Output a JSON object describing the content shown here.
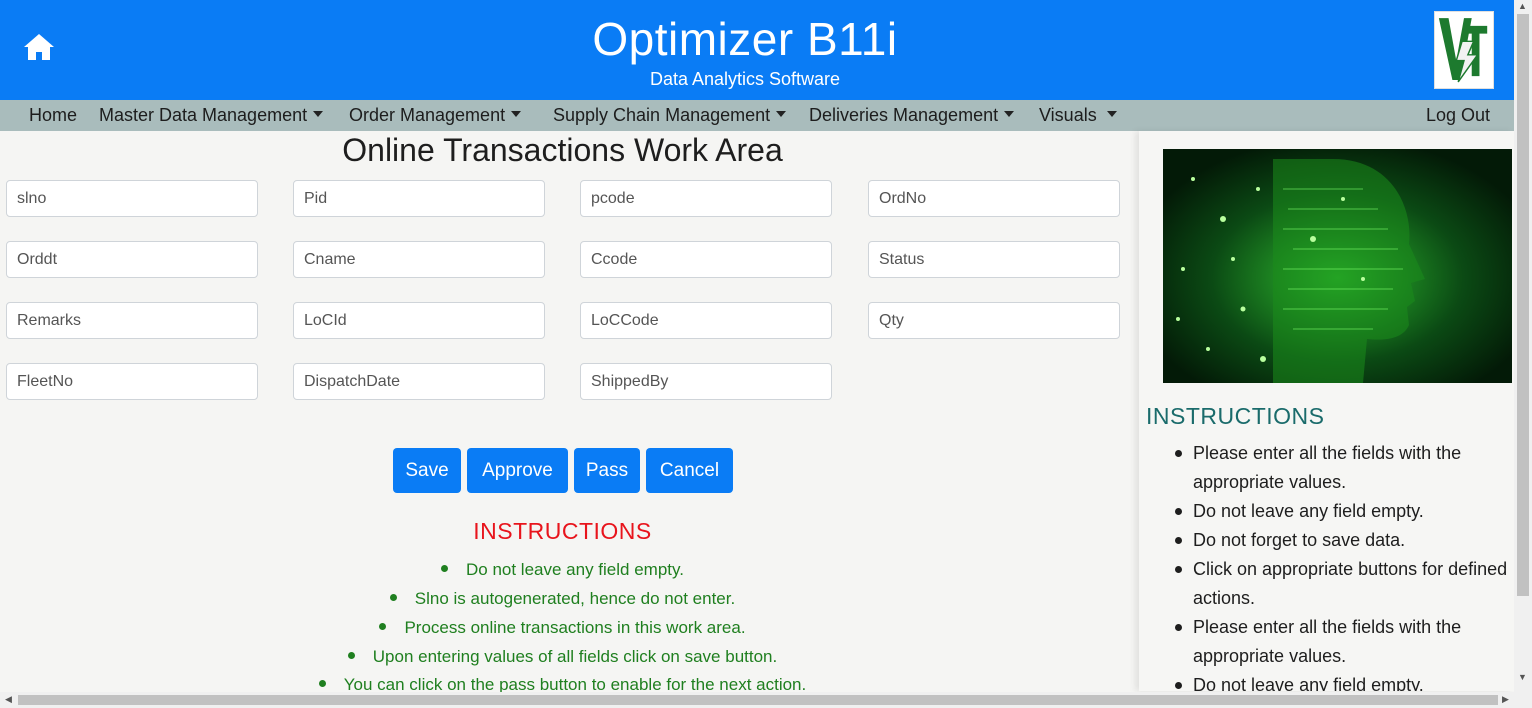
{
  "header": {
    "title": "Optimizer B11i",
    "subtitle": "Data Analytics Software",
    "brand_color": "#0a7cf5"
  },
  "nav": {
    "items": [
      {
        "label": "Home",
        "dropdown": false
      },
      {
        "label": "Master Data Management",
        "dropdown": true
      },
      {
        "label": "Order Management",
        "dropdown": true
      },
      {
        "label": "Supply Chain Management",
        "dropdown": true
      },
      {
        "label": "Deliveries Management",
        "dropdown": true
      },
      {
        "label": "Visuals",
        "dropdown": true
      }
    ],
    "logout": "Log Out"
  },
  "work_area": {
    "title": "Online Transactions Work Area",
    "fields": [
      {
        "placeholder": "slno",
        "value": ""
      },
      {
        "placeholder": "Pid",
        "value": ""
      },
      {
        "placeholder": "pcode",
        "value": ""
      },
      {
        "placeholder": "OrdNo",
        "value": ""
      },
      {
        "placeholder": "Orddt",
        "value": ""
      },
      {
        "placeholder": "Cname",
        "value": ""
      },
      {
        "placeholder": "Ccode",
        "value": ""
      },
      {
        "placeholder": "Status",
        "value": ""
      },
      {
        "placeholder": "Remarks",
        "value": ""
      },
      {
        "placeholder": "LoCId",
        "value": ""
      },
      {
        "placeholder": "LoCCode",
        "value": ""
      },
      {
        "placeholder": "Qty",
        "value": ""
      },
      {
        "placeholder": "FleetNo",
        "value": ""
      },
      {
        "placeholder": "DispatchDate",
        "value": ""
      },
      {
        "placeholder": "ShippedBy",
        "value": ""
      }
    ],
    "buttons": {
      "save": "Save",
      "approve": "Approve",
      "pass": "Pass",
      "cancel": "Cancel"
    },
    "instructions_title": "INSTRUCTIONS",
    "instructions": [
      "Do not leave any field empty.",
      "Slno is autogenerated, hence do not enter.",
      "Process online transactions in this work area.",
      "Upon entering values of all fields click on save button.",
      "You can click on the pass button to enable for the next action."
    ]
  },
  "side_panel": {
    "instructions_title": "INSTRUCTIONS",
    "instructions": [
      "Please enter all the fields with the appropriate values.",
      "Do not leave any field empty.",
      "Do not forget to save data.",
      "Click on appropriate buttons for defined actions.",
      "Please enter all the fields with the appropriate values.",
      "Do not leave any field empty."
    ]
  },
  "icons": {
    "home": "home-icon",
    "logo": "logo-icon",
    "hero_image": "ai-head-circuit-image"
  }
}
